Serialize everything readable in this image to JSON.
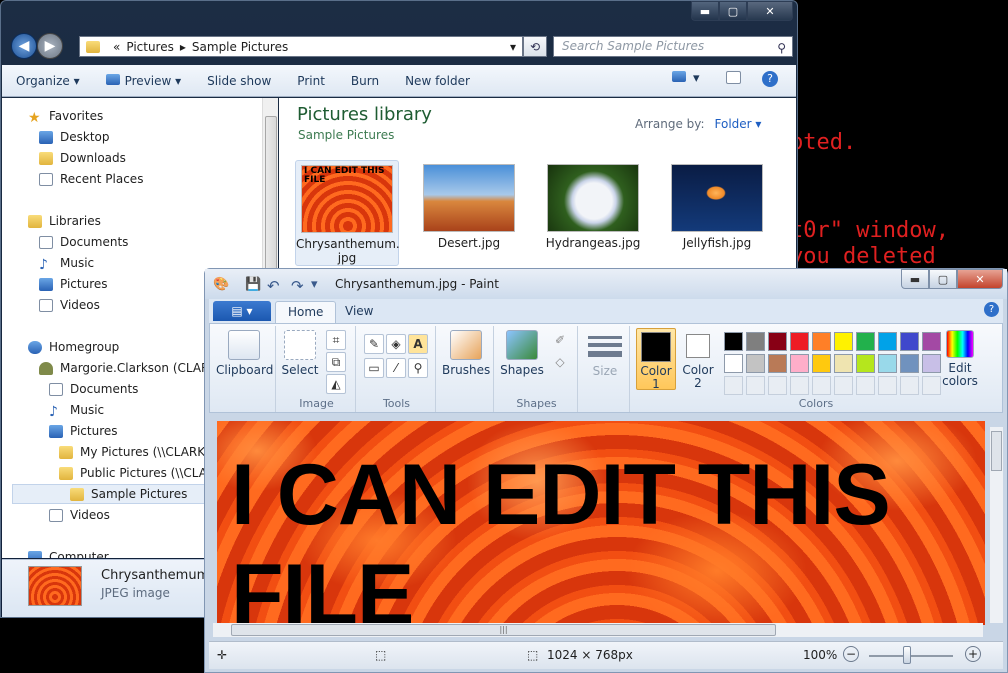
{
  "background_text": [
    "pted.",
    "t0r\" window,",
    "you deleted"
  ],
  "explorer": {
    "caption": {
      "min": "▬",
      "max": "▢",
      "close": "✕"
    },
    "address": {
      "prefix": "«",
      "crumbs": [
        "Pictures",
        "Sample Pictures"
      ],
      "separator": "▸",
      "dropdown": "▾",
      "refresh": "⟲"
    },
    "search_placeholder": "Search Sample Pictures",
    "toolbar": {
      "organize": "Organize ▾",
      "preview": "Preview ▾",
      "slideshow": "Slide show",
      "print": "Print",
      "burn": "Burn",
      "newfolder": "New folder",
      "view": "▾",
      "help": "?"
    },
    "nav": {
      "favorites": "Favorites",
      "desktop": "Desktop",
      "downloads": "Downloads",
      "recent": "Recent Places",
      "libraries": "Libraries",
      "documents": "Documents",
      "music": "Music",
      "pictures": "Pictures",
      "videos": "Videos",
      "homegroup": "Homegroup",
      "user": "Margorie.Clarkson (CLARKSO",
      "hg_documents": "Documents",
      "hg_music": "Music",
      "hg_pictures": "Pictures",
      "my_pictures": "My Pictures (\\\\CLARKSO",
      "public_pictures": "Public Pictures (\\\\CLAR",
      "sample_pictures": "Sample Pictures",
      "hg_videos": "Videos",
      "computer": "Computer"
    },
    "library": {
      "title": "Pictures library",
      "subtitle": "Sample Pictures",
      "arrange_label": "Arrange by:",
      "arrange_value": "Folder ▾"
    },
    "files": [
      {
        "name": "Chrysanthemum.\njpg",
        "colors": [
          "#ff6a1f",
          "#c92a0a"
        ],
        "overlay": "I CAN EDIT THIS FILE"
      },
      {
        "name": "Desert.jpg",
        "colors": [
          "#2a6fb8",
          "#c2551e"
        ]
      },
      {
        "name": "Hydrangeas.jpg",
        "colors": [
          "#2f5f1e",
          "#e6ecf7"
        ]
      },
      {
        "name": "Jellyfish.jpg",
        "colors": [
          "#0a1c44",
          "#f08a28"
        ]
      }
    ],
    "details": {
      "filename": "Chrysanthemum.jpg",
      "type": "JPEG image"
    }
  },
  "paint": {
    "title": "Chrysanthemum.jpg - Paint",
    "caption": {
      "min": "▬",
      "max": "▢",
      "close": "✕"
    },
    "quick_access": {
      "save": "💾",
      "undo": "↶",
      "redo": "↷",
      "more": "▾"
    },
    "tabs": {
      "file": "▤ ▾",
      "home": "Home",
      "view": "View"
    },
    "ribbon": {
      "clipboard": "Clipboard",
      "select": "Select",
      "image_group": "Image",
      "tools_group": "Tools",
      "brushes": "Brushes",
      "shapes": "Shapes",
      "shapes_group": "Shapes",
      "size": "Size",
      "color1": "Color\n1",
      "color2": "Color\n2",
      "colors_group": "Colors",
      "edit_colors": "Edit\ncolors",
      "help": "?"
    },
    "palette_row1": [
      "#000000",
      "#7f7f7f",
      "#880015",
      "#ed1c24",
      "#ff7f27",
      "#fff200",
      "#22b14c",
      "#00a2e8",
      "#3f48cc",
      "#a349a4"
    ],
    "palette_row2": [
      "#ffffff",
      "#c3c3c3",
      "#b97a57",
      "#ffaec9",
      "#ffc90e",
      "#efe4b0",
      "#b5e61d",
      "#99d9ea",
      "#7092be",
      "#c8bfe7"
    ],
    "color1": "#000000",
    "color2": "#ffffff",
    "canvas_text": "I CAN EDIT THIS\nFILE",
    "status": {
      "dimensions": "1024 × 768px",
      "zoom": "100%",
      "minus": "−",
      "plus": "+"
    }
  }
}
